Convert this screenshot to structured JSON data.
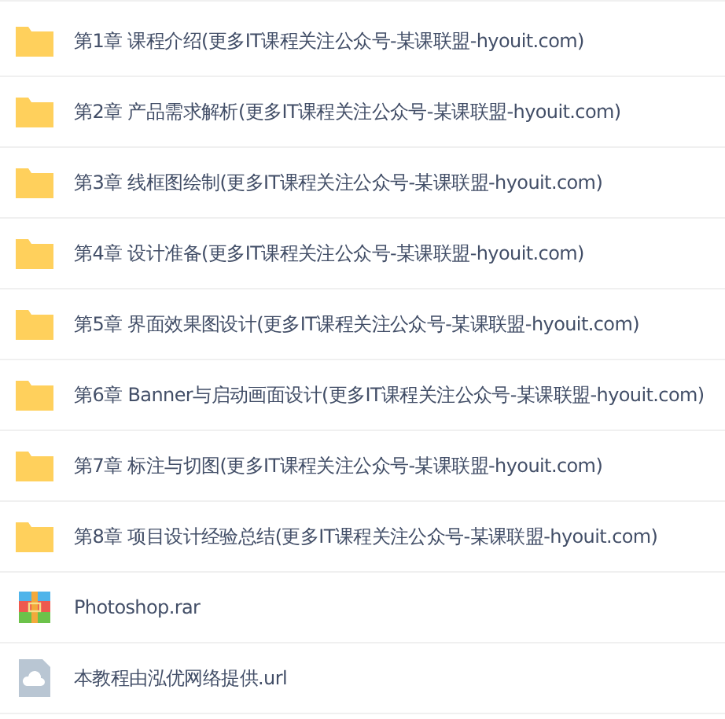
{
  "files": [
    {
      "kind": "folder",
      "name": "第1章 课程介绍(更多IT课程关注公众号-某课联盟-hyouit.com)"
    },
    {
      "kind": "folder",
      "name": "第2章 产品需求解析(更多IT课程关注公众号-某课联盟-hyouit.com)"
    },
    {
      "kind": "folder",
      "name": "第3章 线框图绘制(更多IT课程关注公众号-某课联盟-hyouit.com)"
    },
    {
      "kind": "folder",
      "name": "第4章 设计准备(更多IT课程关注公众号-某课联盟-hyouit.com)"
    },
    {
      "kind": "folder",
      "name": "第5章 界面效果图设计(更多IT课程关注公众号-某课联盟-hyouit.com)"
    },
    {
      "kind": "folder",
      "name": "第6章 Banner与启动画面设计(更多IT课程关注公众号-某课联盟-hyouit.com)"
    },
    {
      "kind": "folder",
      "name": "第7章 标注与切图(更多IT课程关注公众号-某课联盟-hyouit.com)"
    },
    {
      "kind": "folder",
      "name": "第8章 项目设计经验总结(更多IT课程关注公众号-某课联盟-hyouit.com)"
    },
    {
      "kind": "archive",
      "name": "Photoshop.rar"
    },
    {
      "kind": "link",
      "name": "本教程由泓优网络提供.url"
    }
  ]
}
